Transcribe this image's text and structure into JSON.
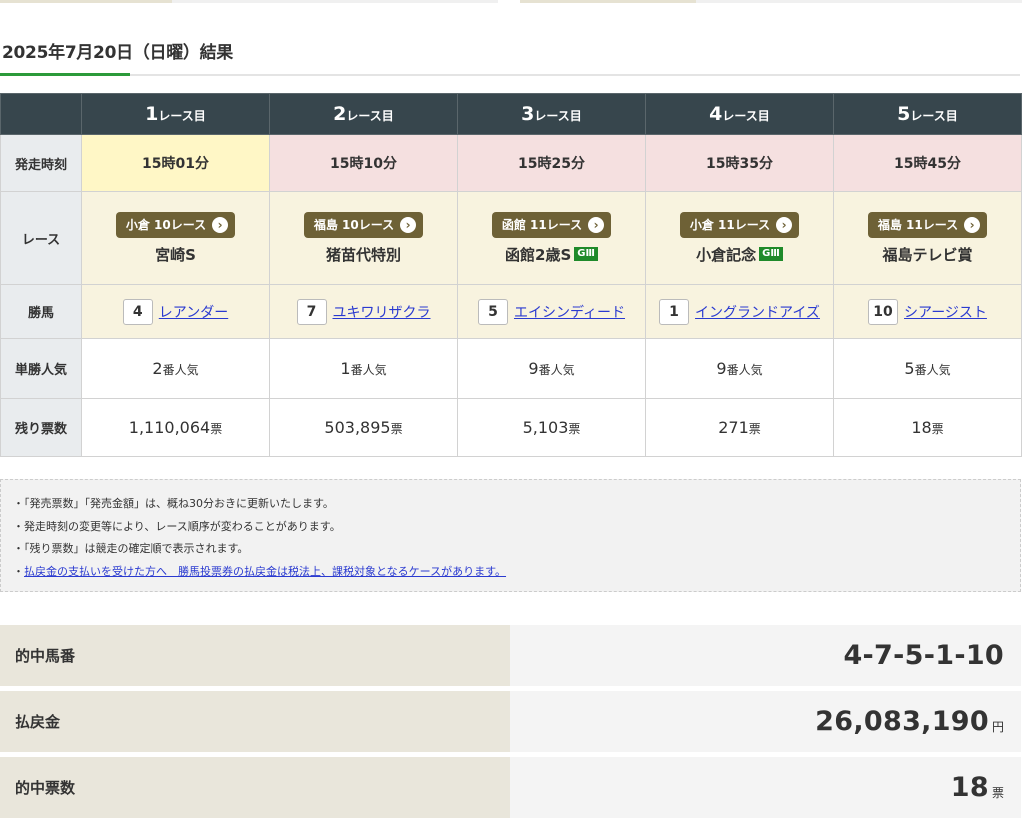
{
  "header": {
    "title": "2025年7月20日（日曜）結果",
    "accent_color": "#2b9a3a"
  },
  "table": {
    "row_headers": {
      "time": "発走時刻",
      "race": "レース",
      "winner": "勝馬",
      "popularity": "単勝人気",
      "remaining": "残り票数"
    },
    "race_suffix": "レース目",
    "popularity_suffix": "番人気",
    "ticket_unit": "票",
    "races": [
      {
        "num": "1",
        "time": "15時01分",
        "time_bg": "#fff7c6",
        "venue": "小倉 10レース",
        "name": "宮崎S",
        "grade": "",
        "horse_num": "4",
        "horse_name": "レアンダー",
        "popularity": "2",
        "remaining": "1,110,064"
      },
      {
        "num": "2",
        "time": "15時10分",
        "time_bg": "#f5e0e0",
        "venue": "福島 10レース",
        "name": "猪苗代特別",
        "grade": "",
        "horse_num": "7",
        "horse_name": "ユキワリザクラ",
        "popularity": "1",
        "remaining": "503,895"
      },
      {
        "num": "3",
        "time": "15時25分",
        "time_bg": "#f5e0e0",
        "venue": "函館 11レース",
        "name": "函館2歳S",
        "grade": "GⅢ",
        "horse_num": "5",
        "horse_name": "エイシンディード",
        "popularity": "9",
        "remaining": "5,103"
      },
      {
        "num": "4",
        "time": "15時35分",
        "time_bg": "#f5e0e0",
        "venue": "小倉 11レース",
        "name": "小倉記念",
        "grade": "GⅢ",
        "horse_num": "1",
        "horse_name": "イングランドアイズ",
        "popularity": "9",
        "remaining": "271"
      },
      {
        "num": "5",
        "time": "15時45分",
        "time_bg": "#f5e0e0",
        "venue": "福島 11レース",
        "name": "福島テレビ賞",
        "grade": "",
        "horse_num": "10",
        "horse_name": "シアージスト",
        "popularity": "5",
        "remaining": "18"
      }
    ]
  },
  "notes": [
    {
      "bullet": "・",
      "text": "「発売票数」「発売金額」は、概ね30分おきに更新いたします。",
      "link": false
    },
    {
      "bullet": "・",
      "text": "発走時刻の変更等により、レース順序が変わることがあります。",
      "link": false
    },
    {
      "bullet": "・",
      "text": "「残り票数」は競走の確定順で表示されます。",
      "link": false
    },
    {
      "bullet": "・",
      "text": "払戻金の支払いを受けた方へ　勝馬投票券の払戻金は税法上、課税対象となるケースがあります。",
      "link": true
    }
  ],
  "summary": {
    "winning_numbers_label": "的中馬番",
    "winning_numbers": "4-7-5-1-10",
    "payout_label": "払戻金",
    "payout": "26,083,190",
    "payout_unit": "円",
    "winning_tickets_label": "的中票数",
    "winning_tickets": "18",
    "winning_tickets_unit": "票"
  }
}
